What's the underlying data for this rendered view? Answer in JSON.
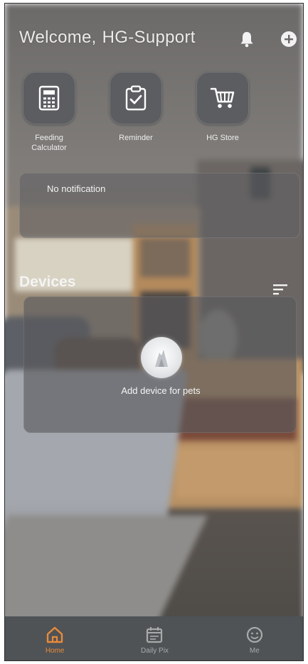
{
  "header": {
    "welcome_prefix": "Welcome,",
    "username": "HG-Support"
  },
  "quick_actions": [
    {
      "label": "Feeding Calculator",
      "icon": "calculator-icon"
    },
    {
      "label": "Reminder",
      "icon": "clipboard-check-icon"
    },
    {
      "label": "HG Store",
      "icon": "cart-icon"
    }
  ],
  "notifications": {
    "text": "No notification"
  },
  "devices": {
    "title": "Devices",
    "add_label": "Add device for pets"
  },
  "tabbar": {
    "items": [
      {
        "label": "Home",
        "icon": "home-icon",
        "active": true
      },
      {
        "label": "Daily Pix",
        "icon": "calendar-icon",
        "active": false
      },
      {
        "label": "Me",
        "icon": "smiley-face-icon",
        "active": false
      }
    ]
  },
  "colors": {
    "accent": "#e98a39",
    "tabbar_bg": "#4f5356",
    "tile_bg": "#5c5d60"
  }
}
